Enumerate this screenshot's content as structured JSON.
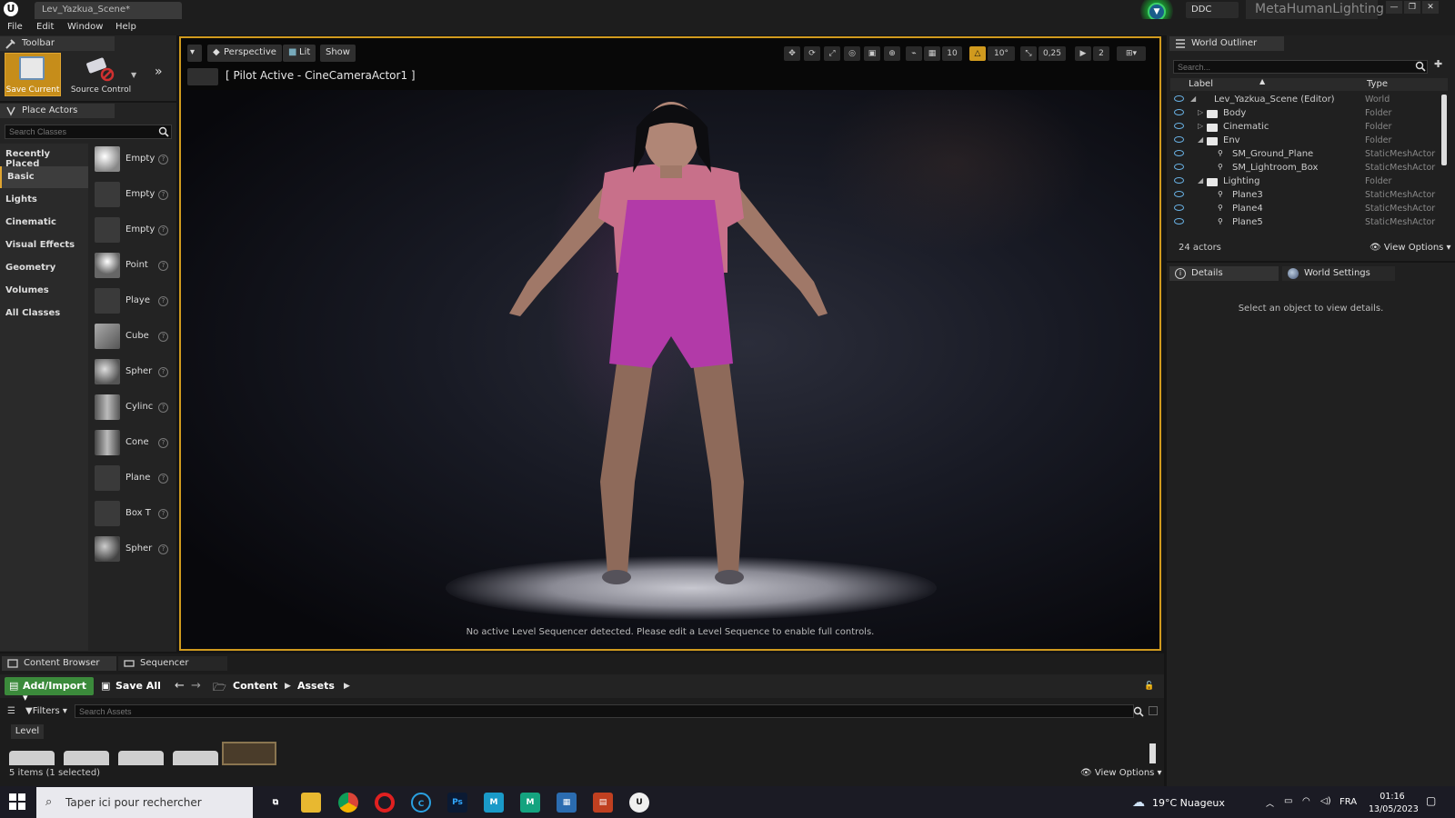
{
  "titlebar": {
    "document_tab": "Lev_Yazkua_Scene*",
    "ddc_label": "DDC",
    "project_name": "MetaHumanLighting"
  },
  "menu": [
    "File",
    "Edit",
    "Window",
    "Help"
  ],
  "toolbar": {
    "tab_label": "Toolbar",
    "save_label": "Save Current",
    "source_control_label": "Source Control"
  },
  "place_actors": {
    "tab_label": "Place Actors",
    "search_placeholder": "Search Classes",
    "categories": [
      "Recently Placed",
      "Basic",
      "Lights",
      "Cinematic",
      "Visual Effects",
      "Geometry",
      "Volumes",
      "All Classes"
    ],
    "active_category": "Basic",
    "actors": [
      "Empty",
      "Empty",
      "Empty",
      "Point",
      "Playe",
      "Cube",
      "Spher",
      "Cylinc",
      "Cone",
      "Plane",
      "Box T",
      "Spher"
    ]
  },
  "viewport": {
    "perspective_label": "Perspective",
    "lit_label": "Lit",
    "show_label": "Show",
    "pilot_text": "[ Pilot Active - CineCameraActor1 ]",
    "grid_size": "10",
    "rotation_snap": "10°",
    "scale_snap": "0,25",
    "camera_speed": "2",
    "sequencer_message": "No active Level Sequencer detected. Please edit a Level Sequence to enable full controls."
  },
  "outliner": {
    "tab_label": "World Outliner",
    "search_placeholder": "Search...",
    "col_label": "Label",
    "col_type": "Type",
    "rows": [
      {
        "label": "Lev_Yazkua_Scene (Editor)",
        "type": "World"
      },
      {
        "label": "Body",
        "type": "Folder"
      },
      {
        "label": "Cinematic",
        "type": "Folder"
      },
      {
        "label": "Env",
        "type": "Folder"
      },
      {
        "label": "SM_Ground_Plane",
        "type": "StaticMeshActor"
      },
      {
        "label": "SM_Lightroom_Box",
        "type": "StaticMeshActor"
      },
      {
        "label": "Lighting",
        "type": "Folder"
      },
      {
        "label": "Plane3",
        "type": "StaticMeshActor"
      },
      {
        "label": "Plane4",
        "type": "StaticMeshActor"
      },
      {
        "label": "Plane5",
        "type": "StaticMeshActor"
      }
    ],
    "actor_count": "24 actors",
    "view_options": "View Options"
  },
  "details": {
    "tab_label": "Details",
    "world_settings_label": "World Settings",
    "empty_message": "Select an object to view details."
  },
  "content_browser": {
    "tab_label": "Content Browser",
    "sequencer_tab": "Sequencer",
    "add_import": "Add/Import",
    "save_all": "Save All",
    "crumb_content": "Content",
    "crumb_assets": "Assets",
    "filters_label": "Filters",
    "search_placeholder": "Search Assets",
    "level_chip": "Level",
    "status": "5 items (1 selected)",
    "view_options": "View Options"
  },
  "taskbar": {
    "search_placeholder": "Taper ici pour rechercher",
    "weather": "19°C  Nuageux",
    "language": "FRA",
    "time": "01:16",
    "date": "13/05/2023"
  },
  "colors": {
    "accent_orange": "#d09a1e",
    "add_import_green": "#3b8a3b",
    "eye_blue": "#6ab4e8"
  }
}
